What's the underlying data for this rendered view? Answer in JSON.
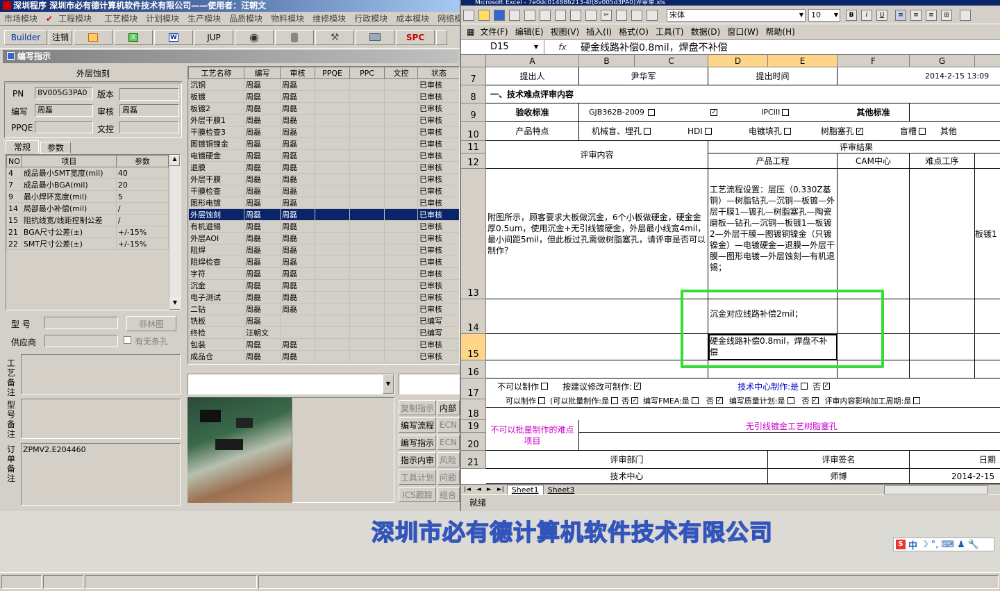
{
  "app": {
    "title": "深圳程序   深圳市必有德计算机软件技术有限公司——使用者：汪朝文",
    "menu": [
      "市场模块",
      "工程模块",
      "工艺模块",
      "计划模块",
      "生产模块",
      "品质模块",
      "物料模块",
      "维修模块",
      "行政模块",
      "成本模块",
      "网络模"
    ],
    "toolbar": [
      "Builder",
      "注销",
      "JUP",
      "SPC"
    ]
  },
  "panel": {
    "title": "编写指示",
    "section": "外层蚀刻",
    "pn_label": "PN",
    "pn_value": "8V005G3PA0",
    "version_label": "版本",
    "version_value": "",
    "editor_label": "编写",
    "editor_value": "周磊",
    "auditor_label": "审核",
    "auditor_value": "周磊",
    "ppqe_label": "PPQE",
    "ppqe_value": "",
    "wenkong_label": "文控",
    "wenkong_value": "",
    "tab1": "常规",
    "tab2": "参数",
    "param_headers": [
      "NO",
      "项目",
      "参数"
    ],
    "params": [
      [
        "4",
        "成品最小SMT宽度(mil)",
        "40"
      ],
      [
        "7",
        "成品最小BGA(mil)",
        "20"
      ],
      [
        "9",
        "最小焊环宽度(mil)",
        "5"
      ],
      [
        "14",
        "局部最小补偿(mil)",
        "/"
      ],
      [
        "15",
        "阻抗线宽/线距控制公差",
        "/"
      ],
      [
        "21",
        "BGA尺寸公差(±)",
        "+/-15%"
      ],
      [
        "22",
        "SMT尺寸公差(±)",
        "+/-15%"
      ]
    ],
    "model_label": "型  号",
    "supplier_label": "供应商",
    "film_btn": "菲林图",
    "no_taper_label": "有无条孔",
    "process_note_label": "工艺备注",
    "model_note_label": "型号备注",
    "order_note_label": "订单备注",
    "order_note_value": "ZPMV2.E204460"
  },
  "process": {
    "headers": [
      "工艺名称",
      "编写",
      "审核",
      "PPQE",
      "PPC",
      "文控",
      "状态"
    ],
    "rows": [
      [
        "沉铜",
        "周磊",
        "周磊",
        "",
        "",
        "",
        "已审核"
      ],
      [
        "板镀",
        "周磊",
        "周磊",
        "",
        "",
        "",
        "已审核"
      ],
      [
        "板镀2",
        "周磊",
        "周磊",
        "",
        "",
        "",
        "已审核"
      ],
      [
        "外层干膜1",
        "周磊",
        "周磊",
        "",
        "",
        "",
        "已审核"
      ],
      [
        "干膜检查3",
        "周磊",
        "周磊",
        "",
        "",
        "",
        "已审核"
      ],
      [
        "图镀铜镍金",
        "周磊",
        "周磊",
        "",
        "",
        "",
        "已审核"
      ],
      [
        "电镀硬金",
        "周磊",
        "周磊",
        "",
        "",
        "",
        "已审核"
      ],
      [
        "退膜",
        "周磊",
        "周磊",
        "",
        "",
        "",
        "已审核"
      ],
      [
        "外层干膜",
        "周磊",
        "周磊",
        "",
        "",
        "",
        "已审核"
      ],
      [
        "干膜检查",
        "周磊",
        "周磊",
        "",
        "",
        "",
        "已审核"
      ],
      [
        "图形电镀",
        "周磊",
        "周磊",
        "",
        "",
        "",
        "已审核"
      ],
      [
        "外层蚀刻",
        "周磊",
        "周磊",
        "",
        "",
        "",
        "已审核"
      ],
      [
        "有机退锡",
        "周磊",
        "周磊",
        "",
        "",
        "",
        "已审核"
      ],
      [
        "外层AOI",
        "周磊",
        "周磊",
        "",
        "",
        "",
        "已审核"
      ],
      [
        "阻焊",
        "周磊",
        "周磊",
        "",
        "",
        "",
        "已审核"
      ],
      [
        "阻焊检查",
        "周磊",
        "周磊",
        "",
        "",
        "",
        "已审核"
      ],
      [
        "字符",
        "周磊",
        "周磊",
        "",
        "",
        "",
        "已审核"
      ],
      [
        "沉金",
        "周磊",
        "周磊",
        "",
        "",
        "",
        "已审核"
      ],
      [
        "电子测试",
        "周磊",
        "周磊",
        "",
        "",
        "",
        "已审核"
      ],
      [
        "二钻",
        "周磊",
        "周磊",
        "",
        "",
        "",
        "已审核"
      ],
      [
        "铣板",
        "周磊",
        "",
        "",
        "",
        "",
        "已编写"
      ],
      [
        "终检",
        "汪朝文",
        "",
        "",
        "",
        "",
        "已编写"
      ],
      [
        "包装",
        "周磊",
        "周磊",
        "",
        "",
        "",
        "已审核"
      ],
      [
        "成品仓",
        "周磊",
        "周磊",
        "",
        "",
        "",
        "已审核"
      ]
    ],
    "selected_index": 11,
    "side_buttons": [
      "复制指示",
      "编写流程",
      "编写指示",
      "指示内审",
      "工具计划",
      "ICS跟踪"
    ],
    "side_buttons2": [
      "内部",
      "ECN",
      "ECN",
      "风险",
      "问题",
      "组合"
    ]
  },
  "excel": {
    "title": "Microsoft Excel - 7e0dc014886213-4f(8v005d3PA0)评审单.xls",
    "font_name": "宋体",
    "font_size": "10",
    "menu": [
      "文件(F)",
      "编辑(E)",
      "视图(V)",
      "插入(I)",
      "格式(O)",
      "工具(T)",
      "数据(D)",
      "窗口(W)",
      "帮助(H)"
    ],
    "name_box": "D15",
    "fx": "fx",
    "formula": "硬金线路补偿0.8mil，焊盘不补偿",
    "columns": [
      "A",
      "B",
      "C",
      "D",
      "E",
      "F",
      "G"
    ],
    "rows": [
      "7",
      "8",
      "9",
      "10",
      "11",
      "12",
      "13",
      "14",
      "15",
      "16",
      "17",
      "18",
      "19",
      "20",
      "21"
    ],
    "r7": {
      "a": "提出人",
      "c": "尹华军",
      "e": "提出时间",
      "g": "2014-2-15  13:09"
    },
    "r8": "一、技术难点评审内容",
    "r9": {
      "std": "验收标准",
      "gjb": "GJB362B-2009",
      "ipc2": "IPCII",
      "ipc3": "IPCIII",
      "other": "其他标准"
    },
    "r10": {
      "feat": "产品特点",
      "mech": "机械盲、埋孔",
      "hdi": "HDI",
      "plate": "电镀填孔",
      "resin": "树脂塞孔",
      "blind": "盲槽",
      "other": "其他"
    },
    "r11": {
      "content": "评审内容",
      "result": "评审结果"
    },
    "r12": {
      "eng": "产品工程",
      "cam": "CAM中心",
      "diff": "难点工序"
    },
    "r13a": "附图所示，顾客要求大板做沉金，6个小板做硬金，硬金金厚0.5um，使用沉金+无引线镀硬金，外层最小线宽4mil，最小间距5mil，但此板过孔需做树脂塞孔，请评审是否可以制作？",
    "r13d": "工艺流程设置：层压（0.330Z基铜）—树脂钻孔—沉铜—板镀—外层干膜1—镀孔—树脂塞孔—陶瓷磨板—钻孔—沉铜—板镀1—板镀2—外层干膜—图镀铜镍金（只镀镍金）—电镀硬金—退膜—外层干膜—图形电镀—外层蚀刻—有机退锡；",
    "r13g": "板镀1",
    "r14d": "沉金对应线路补偿2mil；",
    "r15d": "硬金线路补偿0.8mil，焊盘不补偿",
    "r16": "",
    "r17a": {
      "cannot": "不可以制作",
      "suggest": "按建议修改可制作:",
      "tech": "技术中心制作:是",
      "no": "否"
    },
    "r17b": {
      "can": "可以制作",
      "batch": "(可以批量制作:是",
      "no": "否",
      "fmea": "编写FMEA:是",
      "fno": "否",
      "qplan": "编写质量计划:是",
      "qno": "否",
      "cycle": "评审内容影响加工周期:是"
    },
    "r18": {
      "label": "不可以批量制作的难点项目",
      "value": "无引线镀金工艺树脂塞孔"
    },
    "r20": {
      "dept": "评审部门",
      "sign": "评审签名",
      "date": "日期"
    },
    "r21": {
      "dept": "技术中心",
      "sign": "师博",
      "date": "2014-2-15"
    },
    "sheets": [
      "Sheet1",
      "Sheet3"
    ],
    "status": "就绪"
  },
  "footer": {
    "company": "深圳市必有德计算机软件技术有限公司",
    "ime": "中"
  },
  "colors": {
    "highlight": "#33dd33",
    "selection": "#0a246a",
    "magenta": "#cc00cc",
    "blue": "#0000cc"
  }
}
